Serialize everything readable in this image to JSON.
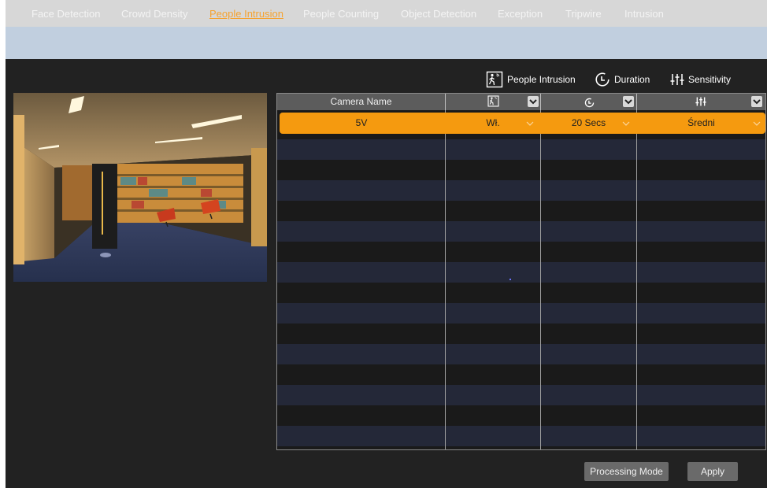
{
  "tabs": [
    {
      "label": "Face Detection",
      "active": false
    },
    {
      "label": "Crowd Density",
      "active": false
    },
    {
      "label": "People Intrusion",
      "active": true
    },
    {
      "label": "People Counting",
      "active": false
    },
    {
      "label": "Object Detection",
      "active": false
    },
    {
      "label": "Exception",
      "active": false
    },
    {
      "label": "Tripwire",
      "active": false
    },
    {
      "label": "Intrusion",
      "active": false
    }
  ],
  "legend": {
    "people_intrusion": {
      "icon": "people-intrusion-icon",
      "label": "People Intrusion"
    },
    "duration": {
      "icon": "clock-icon",
      "label": "Duration"
    },
    "sensitivity": {
      "icon": "sliders-icon",
      "label": "Sensitivity"
    }
  },
  "table": {
    "columns": [
      {
        "label": "Camera Name"
      },
      {
        "icon": "people-intrusion-icon"
      },
      {
        "icon": "clock-icon"
      },
      {
        "icon": "sliders-icon"
      }
    ],
    "rows": [
      {
        "camera_name": "5V",
        "enable": "Wł.",
        "duration": "20 Secs",
        "sensitivity": "Średni",
        "selected": true
      }
    ]
  },
  "buttons": {
    "processing_mode": "Processing Mode",
    "apply": "Apply"
  },
  "colors": {
    "accent": "#f59a0f",
    "active_tab": "#f5a22f",
    "background": "#222222",
    "row_stripe": "#242838"
  }
}
